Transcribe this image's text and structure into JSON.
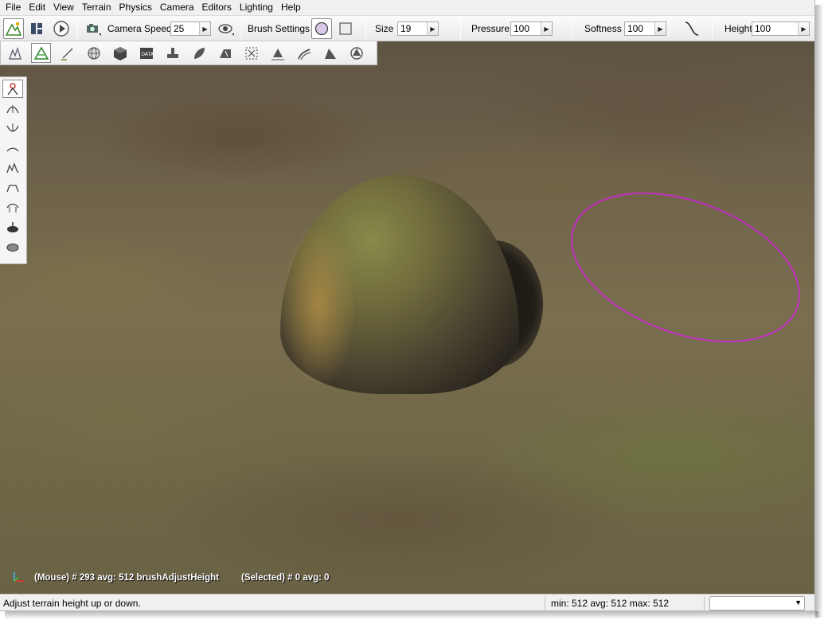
{
  "menu": [
    "File",
    "Edit",
    "View",
    "Terrain",
    "Physics",
    "Camera",
    "Editors",
    "Lighting",
    "Help"
  ],
  "toolbar": {
    "camera_speed_label": "Camera Speed",
    "camera_speed_value": "25",
    "brush_settings_label": "Brush Settings",
    "size_label": "Size",
    "size_value": "19",
    "pressure_label": "Pressure",
    "pressure_value": "100",
    "softness_label": "Softness",
    "softness_value": "100",
    "height_label": "Height",
    "height_value": "100"
  },
  "viewport": {
    "mouse_info": "(Mouse) # 293  avg: 512 brushAdjustHeight",
    "selected_info": "(Selected) # 0  avg: 0",
    "terrain_color": "#6e634a",
    "brush_ring_color": "#c42dc4"
  },
  "status": {
    "hint": "Adjust terrain height up or down.",
    "height_stats": "min: 512  avg: 512  max: 512",
    "combo_value": ""
  },
  "icons": {
    "secondary_toolbar": [
      "object-selection-icon",
      "terrain-editor-icon",
      "terrain-painter-icon",
      "world-editor-icon",
      "object-icon",
      "datablock-icon",
      "decal-icon",
      "forest-icon",
      "road-icon",
      "mesh-road-icon",
      "river-icon",
      "nav-mesh-icon",
      "shape-editor-icon",
      "particle-editor-icon",
      "cloud-layer-icon",
      "camera-path-icon"
    ],
    "palette": [
      "grab-terrain-icon",
      "raise-height-icon",
      "lower-height-icon",
      "smooth-icon",
      "noise-icon",
      "flatten-icon",
      "paint-noise-icon",
      "clear-terrain-icon",
      "restore-terrain-icon"
    ]
  }
}
